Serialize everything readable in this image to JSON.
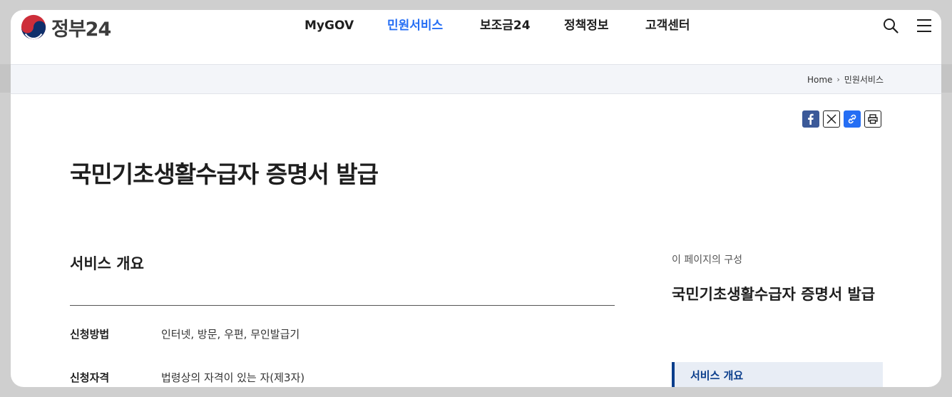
{
  "header": {
    "logo_text": "정부24",
    "nav": [
      "MyGOV",
      "민원서비스",
      "보조금24",
      "정책정보",
      "고객센터"
    ],
    "active_nav": "민원서비스"
  },
  "breadcrumb": {
    "home": "Home",
    "current": "민원서비스"
  },
  "page": {
    "title": "국민기초생활수급자 증명서 발급"
  },
  "overview": {
    "section_title": "서비스 개요",
    "rows": [
      {
        "label": "신청방법",
        "value": "인터넷, 방문, 우편, 무인발급기"
      },
      {
        "label": "신청자격",
        "value": "법령상의 자격이 있는 자(제3자)"
      }
    ]
  },
  "side": {
    "label": "이 페이지의 구성",
    "title": "국민기초생활수급자 증명서 발급",
    "items": [
      "서비스 개요"
    ]
  },
  "colors": {
    "accent": "#256ef4",
    "nav_active": "#256ef4",
    "side_accent": "#0b3e8c",
    "facebook": "#3b5998"
  }
}
